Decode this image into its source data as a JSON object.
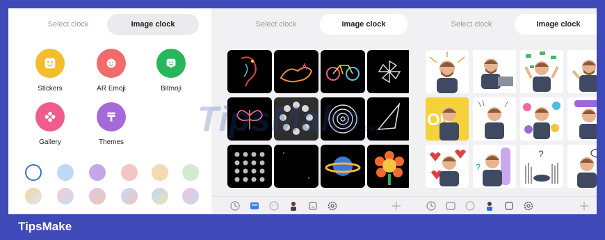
{
  "panels": [
    {
      "tabs": [
        "Select clock",
        "Image clock"
      ],
      "active": 1
    },
    {
      "tabs": [
        "Select clock",
        "Image clock"
      ],
      "active": 1
    },
    {
      "tabs": [
        "Select clock",
        "Image clock"
      ],
      "active": 1
    }
  ],
  "apps": [
    {
      "label": "Stickers",
      "color": "#f6bc2c"
    },
    {
      "label": "AR Emoji",
      "color": "#f26b6b"
    },
    {
      "label": "Bitmoji",
      "color": "#28b55b"
    },
    {
      "label": "Gallery",
      "color": "#f05d8c"
    },
    {
      "label": "Themes",
      "color": "#a56ad9"
    }
  ],
  "swatches": [
    "#ffffff",
    "#bcd9f5",
    "#c6a6ea",
    "#f3c6c6",
    "#f4d9b2",
    "#d3ead2",
    "#f1d8b0",
    "#d8c5ec",
    "#eec3a6",
    "#b9d7f1",
    "#c9e0ea",
    "#f2c3d8"
  ],
  "watermark": {
    "text": "TipsMake",
    "sub": ".com"
  },
  "footer": {
    "brand": "TipsMake"
  }
}
